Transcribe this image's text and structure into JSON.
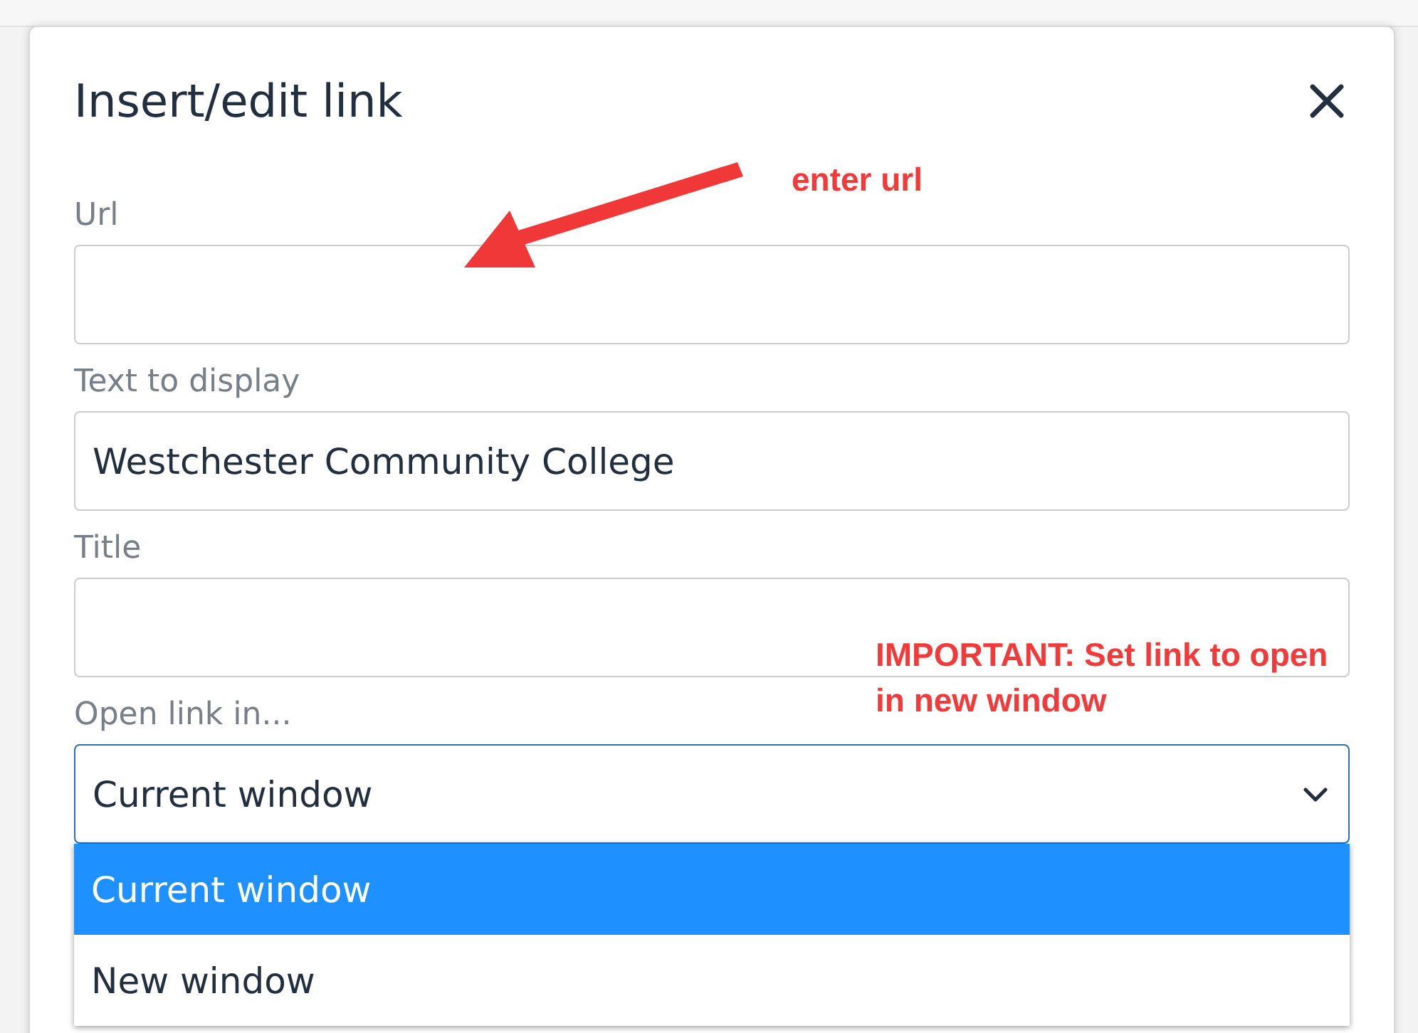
{
  "dialog": {
    "title": "Insert/edit link",
    "fields": [
      {
        "kind": "text",
        "label": "Url"
      },
      {
        "kind": "text",
        "label": "Text to display",
        "value": "Westchester Community College"
      },
      {
        "kind": "text",
        "label": "Title"
      },
      {
        "kind": "select",
        "label": "Open link in...",
        "value": "Current window",
        "open": true,
        "options": [
          {
            "label": "Current window",
            "selected": true
          },
          {
            "label": "New window",
            "selected": false
          }
        ]
      }
    ]
  },
  "annotations": [
    {
      "text": "enter url",
      "arrow": true
    },
    {
      "text": "IMPORTANT: Set link to open in new window",
      "arrow": false
    }
  ]
}
